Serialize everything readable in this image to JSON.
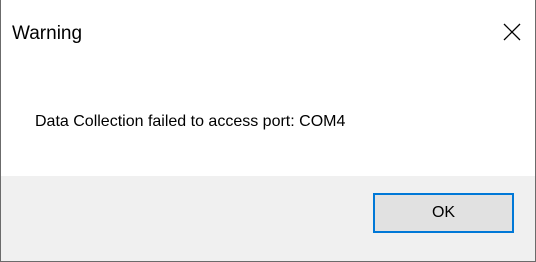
{
  "window": {
    "title": "Warning"
  },
  "titlebar": {
    "close_icon": "close-icon"
  },
  "message": {
    "text": "Data Collection failed to access port: COM4"
  },
  "buttons": {
    "ok_label": "OK"
  },
  "colors": {
    "footer_background": "#f0f0f0",
    "button_background": "#e1e1e1",
    "button_focus_border": "#0078d7",
    "window_border": "#6b6b6b"
  }
}
